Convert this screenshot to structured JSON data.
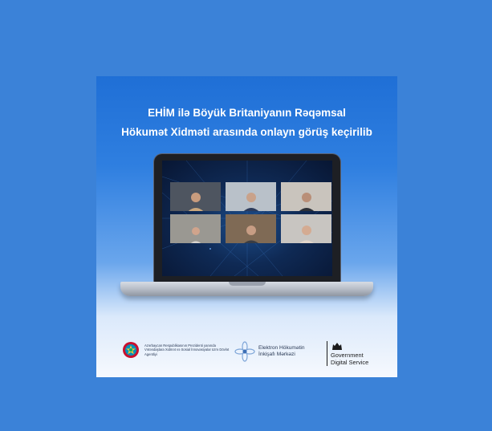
{
  "headline": {
    "line1": "EHİM ilə Böyük Britaniyanın Rəqəmsal",
    "line2": "Hökumət Xidməti arasında onlayn görüş keçirilib"
  },
  "video_call": {
    "participants": [
      {
        "name": "participant-1",
        "shirt": "#c9a77e",
        "bg": "#4e5560"
      },
      {
        "name": "participant-2",
        "shirt": "#2b3a5a",
        "bg": "#b9c1c9"
      },
      {
        "name": "participant-3",
        "shirt": "#2d3138",
        "bg": "#c9c4bd"
      },
      {
        "name": "participant-4",
        "shirt": "#d9d4cf",
        "bg": "#9a9892"
      },
      {
        "name": "participant-5",
        "shirt": "#3a3d44",
        "bg": "#7f6a55"
      },
      {
        "name": "participant-6",
        "shirt": "#e3d6cb",
        "bg": "#c8c5c1"
      }
    ]
  },
  "footer": {
    "az_agency": "Azərbaycan Respublikasının Prezidenti yanında Vətəndaşlara Xidmət və Sosial İnnovasiyalar üzrə Dövlət Agentliyi",
    "ehim_line1": "Elektron Hökumətin",
    "ehim_line2": "İnkişafı Mərkəzi",
    "gds_line1": "Government",
    "gds_line2": "Digital Service"
  },
  "colors": {
    "page_background": "#3b82d8",
    "accent": "#1f6fd6",
    "headline_text": "#ffffff"
  }
}
